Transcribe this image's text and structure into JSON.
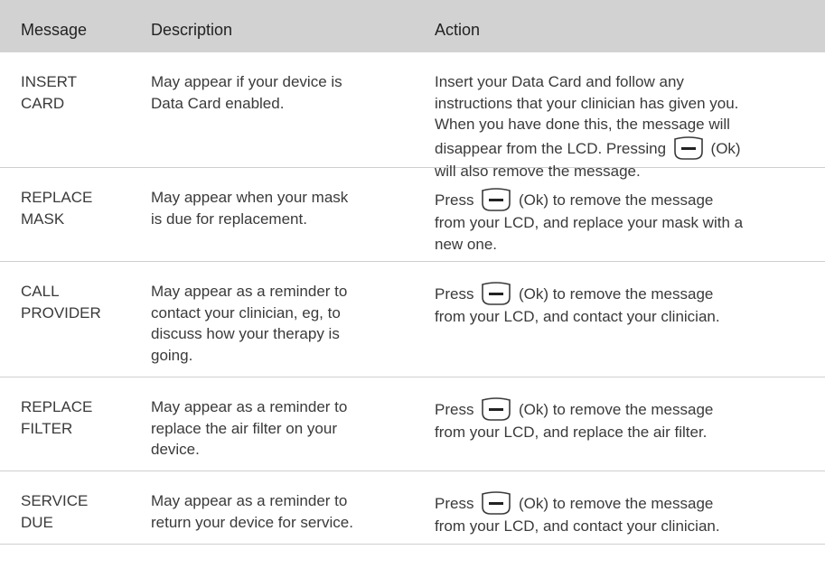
{
  "headers": {
    "message": "Message",
    "description": "Description",
    "action": "Action"
  },
  "rows": [
    {
      "message": "INSERT\nCARD",
      "description": "May appear if your device is\nData Card enabled.",
      "action_before": "Insert your Data Card and follow any\ninstructions that your clinician has given you.\nWhen you have done this, the message will\ndisappear from the LCD. Pressing",
      "action_after": "(Ok)\nwill also remove the message."
    },
    {
      "message": "REPLACE\nMASK",
      "description": "May appear when your mask\nis due for replacement.",
      "action_before": "Press",
      "action_after": "(Ok) to remove the message\nfrom your LCD, and replace your mask with a\nnew one."
    },
    {
      "message": "CALL\nPROVIDER",
      "description": "May appear as a reminder to\ncontact your clinician, eg, to\ndiscuss how your therapy is\ngoing.",
      "action_before": "Press",
      "action_after": "(Ok) to remove the message\nfrom your LCD, and contact your clinician."
    },
    {
      "message": "REPLACE\nFILTER",
      "description": "May appear as a reminder to\nreplace the air filter on your\ndevice.",
      "action_before": "Press",
      "action_after": "(Ok) to remove the message\nfrom your LCD, and replace the air filter."
    },
    {
      "message": "SERVICE\nDUE",
      "description": "May appear as a reminder to\nreturn your device for service.",
      "action_before": "Press",
      "action_after": "(Ok) to remove the message\nfrom your LCD, and contact your clinician."
    }
  ],
  "icons": {
    "ok_key": "ok-key-icon"
  }
}
